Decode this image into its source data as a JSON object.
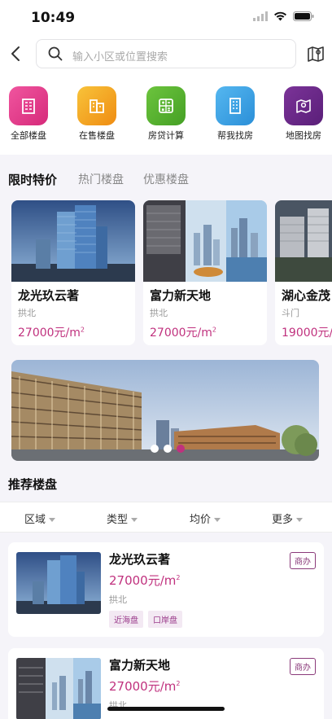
{
  "status": {
    "time": "10:49"
  },
  "search": {
    "placeholder": "输入小区或位置搜索"
  },
  "quick_nav": [
    {
      "label": "全部楼盘",
      "color": "#e33b8d",
      "icon": "building-icon"
    },
    {
      "label": "在售楼盘",
      "color": "#f3a521",
      "icon": "on-sale-icon"
    },
    {
      "label": "房贷计算",
      "color": "#58b431",
      "icon": "calculator-icon"
    },
    {
      "label": "帮我找房",
      "color": "#3aa3e6",
      "icon": "find-house-icon"
    },
    {
      "label": "地图找房",
      "color": "#6b2a89",
      "icon": "map-icon"
    }
  ],
  "tabs": [
    {
      "label": "限时特价",
      "active": true
    },
    {
      "label": "热门楼盘",
      "active": false
    },
    {
      "label": "优惠楼盘",
      "active": false
    }
  ],
  "featured": [
    {
      "name": "龙光玖云著",
      "area": "拱北",
      "price": "27000元/m",
      "unit_sup": "2"
    },
    {
      "name": "富力新天地",
      "area": "拱北",
      "price": "27000元/m",
      "unit_sup": "2"
    },
    {
      "name": "湖心金茂",
      "area": "斗门",
      "price": "19000元/",
      "unit_sup": ""
    }
  ],
  "banner": {
    "slides": 3,
    "active": 2
  },
  "recommend": {
    "title": "推荐楼盘"
  },
  "filters": [
    "区域",
    "类型",
    "均价",
    "更多"
  ],
  "listings": [
    {
      "name": "龙光玖云著",
      "price": "27000元/m",
      "unit_sup": "2",
      "area": "拱北",
      "tags": [
        "近海盘",
        "口岸盘"
      ],
      "badge": "商办"
    },
    {
      "name": "富力新天地",
      "price": "27000元/m",
      "unit_sup": "2",
      "area": "拱北",
      "tags": [],
      "badge": "商办"
    }
  ],
  "colors": {
    "accent": "#c0317e"
  }
}
